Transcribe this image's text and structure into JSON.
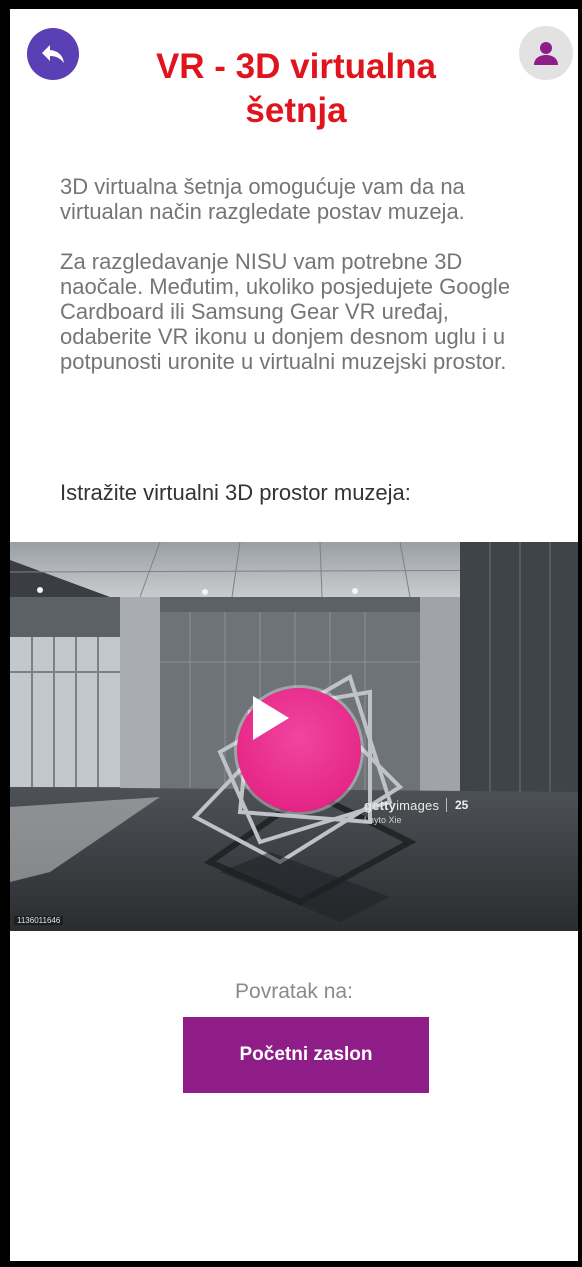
{
  "header": {
    "title_line1": "VR - 3D virtualna",
    "title_line2": "šetnja",
    "back_icon": "reply-arrow-icon",
    "profile_icon": "user-icon",
    "colors": {
      "title": "#e0141c",
      "back_button": "#5b3fb5",
      "profile_button": "#e2e2e2",
      "profile_icon": "#8e1d87"
    }
  },
  "intro": {
    "paragraph1": "3D virtualna šetnja omogućuje vam da na virtualan način razgledate postav muzeja.",
    "paragraph2": "Za razgledavanje NISU vam potrebne 3D naočale. Međutim, ukoliko posjedujete Google Cardboard ili Samsung Gear VR uređaj, odaberite VR ikonu u donjem desnom uglu i u potpunosti uronite u virtualni muzejski prostor."
  },
  "explore_label": "Istražite virtualni 3D prostor muzeja:",
  "video": {
    "play_icon": "play-icon",
    "watermark_brand_bold": "getty",
    "watermark_brand_light": "images",
    "watermark_badge": "25",
    "watermark_author": "Layto Xie",
    "image_id": "1136011646",
    "colors": {
      "play_button": "#e62788"
    }
  },
  "footer": {
    "return_label": "Povratak na:",
    "home_button": "Početni zaslon",
    "colors": {
      "home_button": "#8e1d87"
    }
  }
}
